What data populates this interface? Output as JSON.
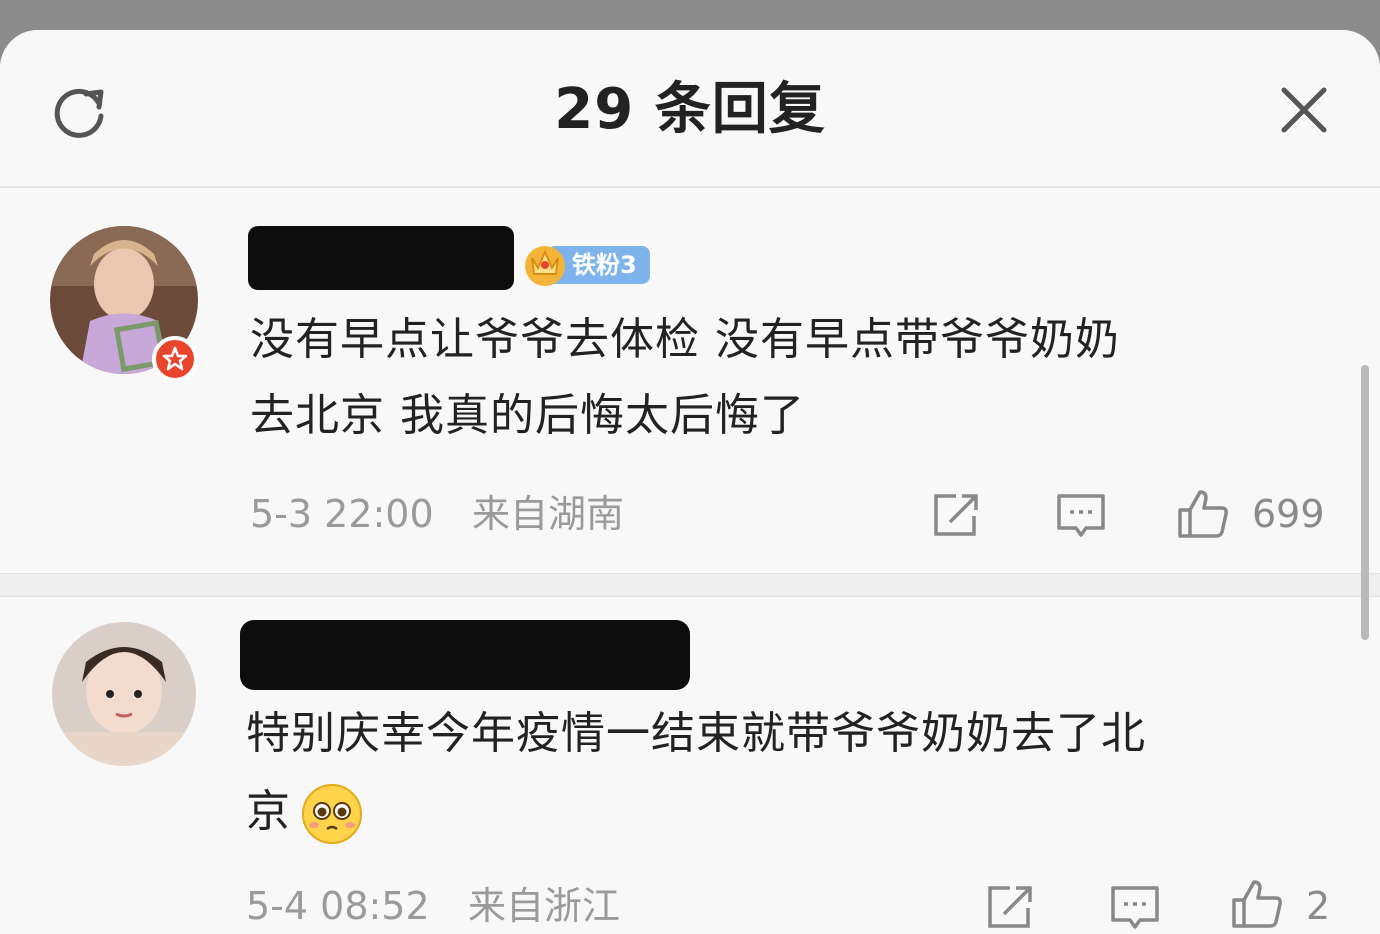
{
  "header": {
    "title": "29 条回复",
    "refresh_icon": "refresh-icon",
    "close_icon": "close-icon"
  },
  "comments": [
    {
      "badge_label": "铁粉3",
      "text_line1": "没有早点让爷爷去体检 没有早点带爷爷奶奶",
      "text_line2": "去北京 我真的后悔太后悔了",
      "timestamp": "5-3 22:00",
      "location": "来自湖南",
      "likes": "699"
    },
    {
      "text_line1": "特别庆幸今年疫情一结束就带爷爷奶奶去了北",
      "text_line2": "京",
      "timestamp": "5-4 08:52",
      "location": "来自浙江",
      "likes": "2"
    }
  ],
  "colors": {
    "text": "#222222",
    "meta": "#9a9a9a",
    "fan_badge": "#7fb3eb",
    "verified_badge": "#e8452c"
  }
}
